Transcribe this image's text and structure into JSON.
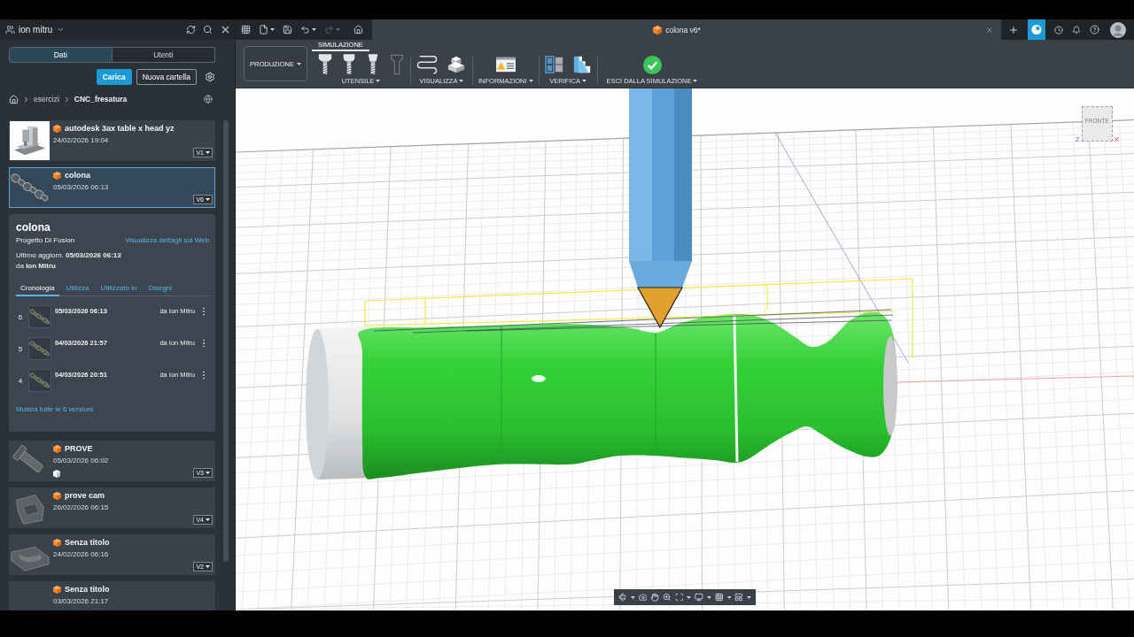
{
  "account": {
    "name": "ion mitru"
  },
  "quick_access": [
    {
      "kind": "apps",
      "disabled": false
    },
    {
      "kind": "file",
      "disabled": false
    },
    {
      "kind": "save",
      "disabled": false
    },
    {
      "kind": "undo",
      "disabled": false
    },
    {
      "kind": "redo",
      "disabled": true
    },
    {
      "kind": "home",
      "disabled": false
    }
  ],
  "document": {
    "title": "colona v6*"
  },
  "panel": {
    "tabs": [
      {
        "label": "Dati",
        "selected": true
      },
      {
        "label": "Utenti",
        "selected": false
      }
    ],
    "actions": [
      {
        "label": "Carica",
        "kind": "primary"
      },
      {
        "label": "Nuova cartella",
        "kind": "secondary"
      }
    ],
    "breadcrumb": [
      "esercizi",
      "CNC_fresatura"
    ],
    "files": [
      {
        "name": "autodesk 3ax table x head yz",
        "date": "24/02/2026 19:04",
        "version": "V1",
        "kind": "machine",
        "selected": false,
        "marker": false
      },
      {
        "name": "colona",
        "date": "05/03/2026 06:13",
        "version": "V6",
        "kind": "column",
        "selected": true,
        "marker": false
      },
      {
        "name": "PROVE",
        "date": "05/03/2026 06:02",
        "version": "V3",
        "kind": "pin",
        "selected": false,
        "marker": true
      },
      {
        "name": "prove cam",
        "date": "26/02/2026 06:15",
        "version": "V4",
        "kind": "bracket",
        "selected": false,
        "marker": false
      },
      {
        "name": "Senza titolo",
        "date": "24/02/2026 06:16",
        "version": "V2",
        "kind": "saddle",
        "selected": false,
        "marker": false
      },
      {
        "name": "Senza titolo",
        "date": "03/03/2026 21:17",
        "kind": "blank",
        "selected": false,
        "marker": false
      }
    ],
    "details": {
      "title": "colona",
      "project": "Progetto Di Fusion",
      "web_link": "Visualizza dettagli sul Web",
      "updated": "Ultimo aggiorn. **05/03/2026 06:13**",
      "author": "da **Ion Mitru**",
      "tabs": [
        {
          "label": "Cronologia",
          "selected": true
        },
        {
          "label": "Utilizza",
          "selected": false
        },
        {
          "label": "Utilizzato in",
          "selected": false
        },
        {
          "label": "Disegni",
          "selected": false
        }
      ],
      "versions": [
        {
          "number": "6",
          "date": "05/03/2026 06:13",
          "author": "da Ion Mitru"
        },
        {
          "number": "5",
          "date": "04/03/2026 21:57",
          "author": "da Ion Mitru"
        },
        {
          "number": "4",
          "date": "04/03/2026 20:51",
          "author": "da Ion Mitru"
        }
      ],
      "show_all": "Mostra tutte le 6 versioni"
    }
  },
  "toolbar": {
    "workspace": "PRODUZIONE",
    "tabs": [
      {
        "label": "SIMULAZIONE",
        "selected": true
      }
    ],
    "groups": [
      {
        "label": "UTENSILE",
        "tools": [
          {
            "kind": "flat-mill",
            "disabled": false
          },
          {
            "kind": "ball-mill",
            "disabled": false
          },
          {
            "kind": "chamfer-mill",
            "disabled": false
          },
          {
            "kind": "holder",
            "disabled": true
          }
        ]
      },
      {
        "label": "VISUALIZZA",
        "tools": [
          {
            "kind": "toolpath",
            "disabled": false
          },
          {
            "kind": "stock",
            "disabled": false
          }
        ]
      },
      {
        "label": "INFORMAZIONI",
        "tools": [
          {
            "kind": "warning-report",
            "disabled": false
          }
        ]
      },
      {
        "label": "VERIFICA",
        "tools": [
          {
            "kind": "compare",
            "disabled": false
          },
          {
            "kind": "section",
            "disabled": false
          }
        ]
      },
      {
        "label": "ESCI DALLA SIMULAZIONE",
        "tools": [
          {
            "kind": "exit",
            "disabled": false
          }
        ]
      }
    ]
  },
  "viewport": {
    "view_cube": {
      "face": "FRONTE",
      "axis_labels": [
        "Z",
        "X"
      ]
    }
  }
}
